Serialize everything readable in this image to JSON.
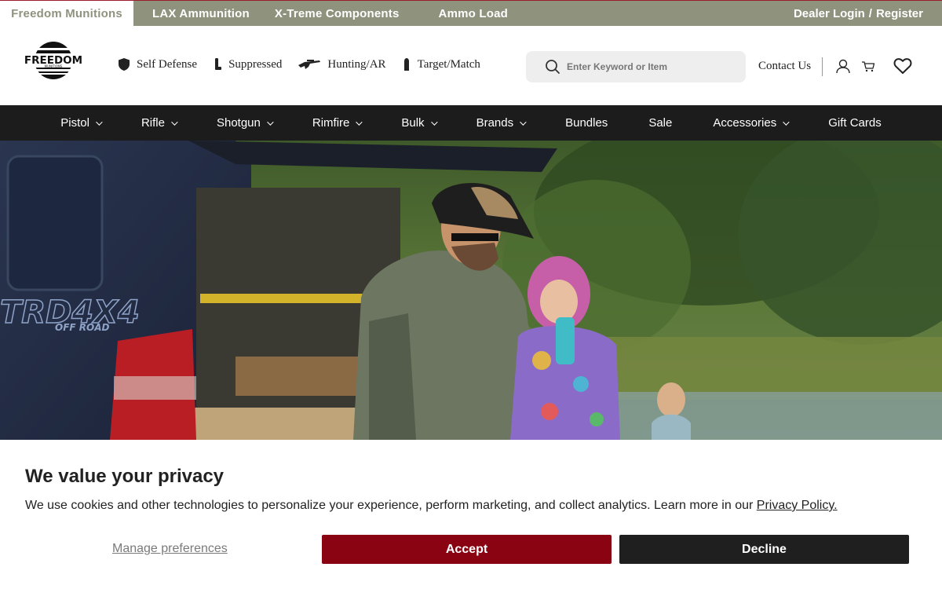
{
  "topbar": {
    "brands": [
      "Freedom Munitions",
      "LAX Ammunition",
      "X-Treme Components",
      "Ammo Load"
    ],
    "dealer_login": "Dealer Login",
    "separator": "/",
    "register": "Register"
  },
  "header": {
    "logo_text": "FREEDOM",
    "logo_subtext": "MUNITIONS",
    "categories": [
      "Self Defense",
      "Suppressed",
      "Hunting/AR",
      "Target/Match"
    ],
    "search_placeholder": "Enter Keyword or Item",
    "contact": "Contact Us"
  },
  "nav": {
    "items": [
      {
        "label": "Pistol",
        "dropdown": true
      },
      {
        "label": "Rifle",
        "dropdown": true
      },
      {
        "label": "Shotgun",
        "dropdown": true
      },
      {
        "label": "Rimfire",
        "dropdown": true
      },
      {
        "label": "Bulk",
        "dropdown": true
      },
      {
        "label": "Brands",
        "dropdown": true
      },
      {
        "label": "Bundles",
        "dropdown": false
      },
      {
        "label": "Sale",
        "dropdown": false
      },
      {
        "label": "Accessories",
        "dropdown": true
      },
      {
        "label": "Gift Cards",
        "dropdown": false
      }
    ]
  },
  "hero": {
    "truck_badge": "TRD4X4",
    "truck_sub": "OFF ROAD"
  },
  "cookie": {
    "title": "We value your privacy",
    "body": "We use cookies and other technologies to personalize your experience, perform marketing, and collect analytics. Learn more in our",
    "policy_link": "Privacy Policy.",
    "manage": "Manage preferences",
    "accept": "Accept",
    "decline": "Decline"
  },
  "colors": {
    "topbar": "#8f937e",
    "accent_red": "#8a0313",
    "nav_bg": "#1c1c1c"
  }
}
